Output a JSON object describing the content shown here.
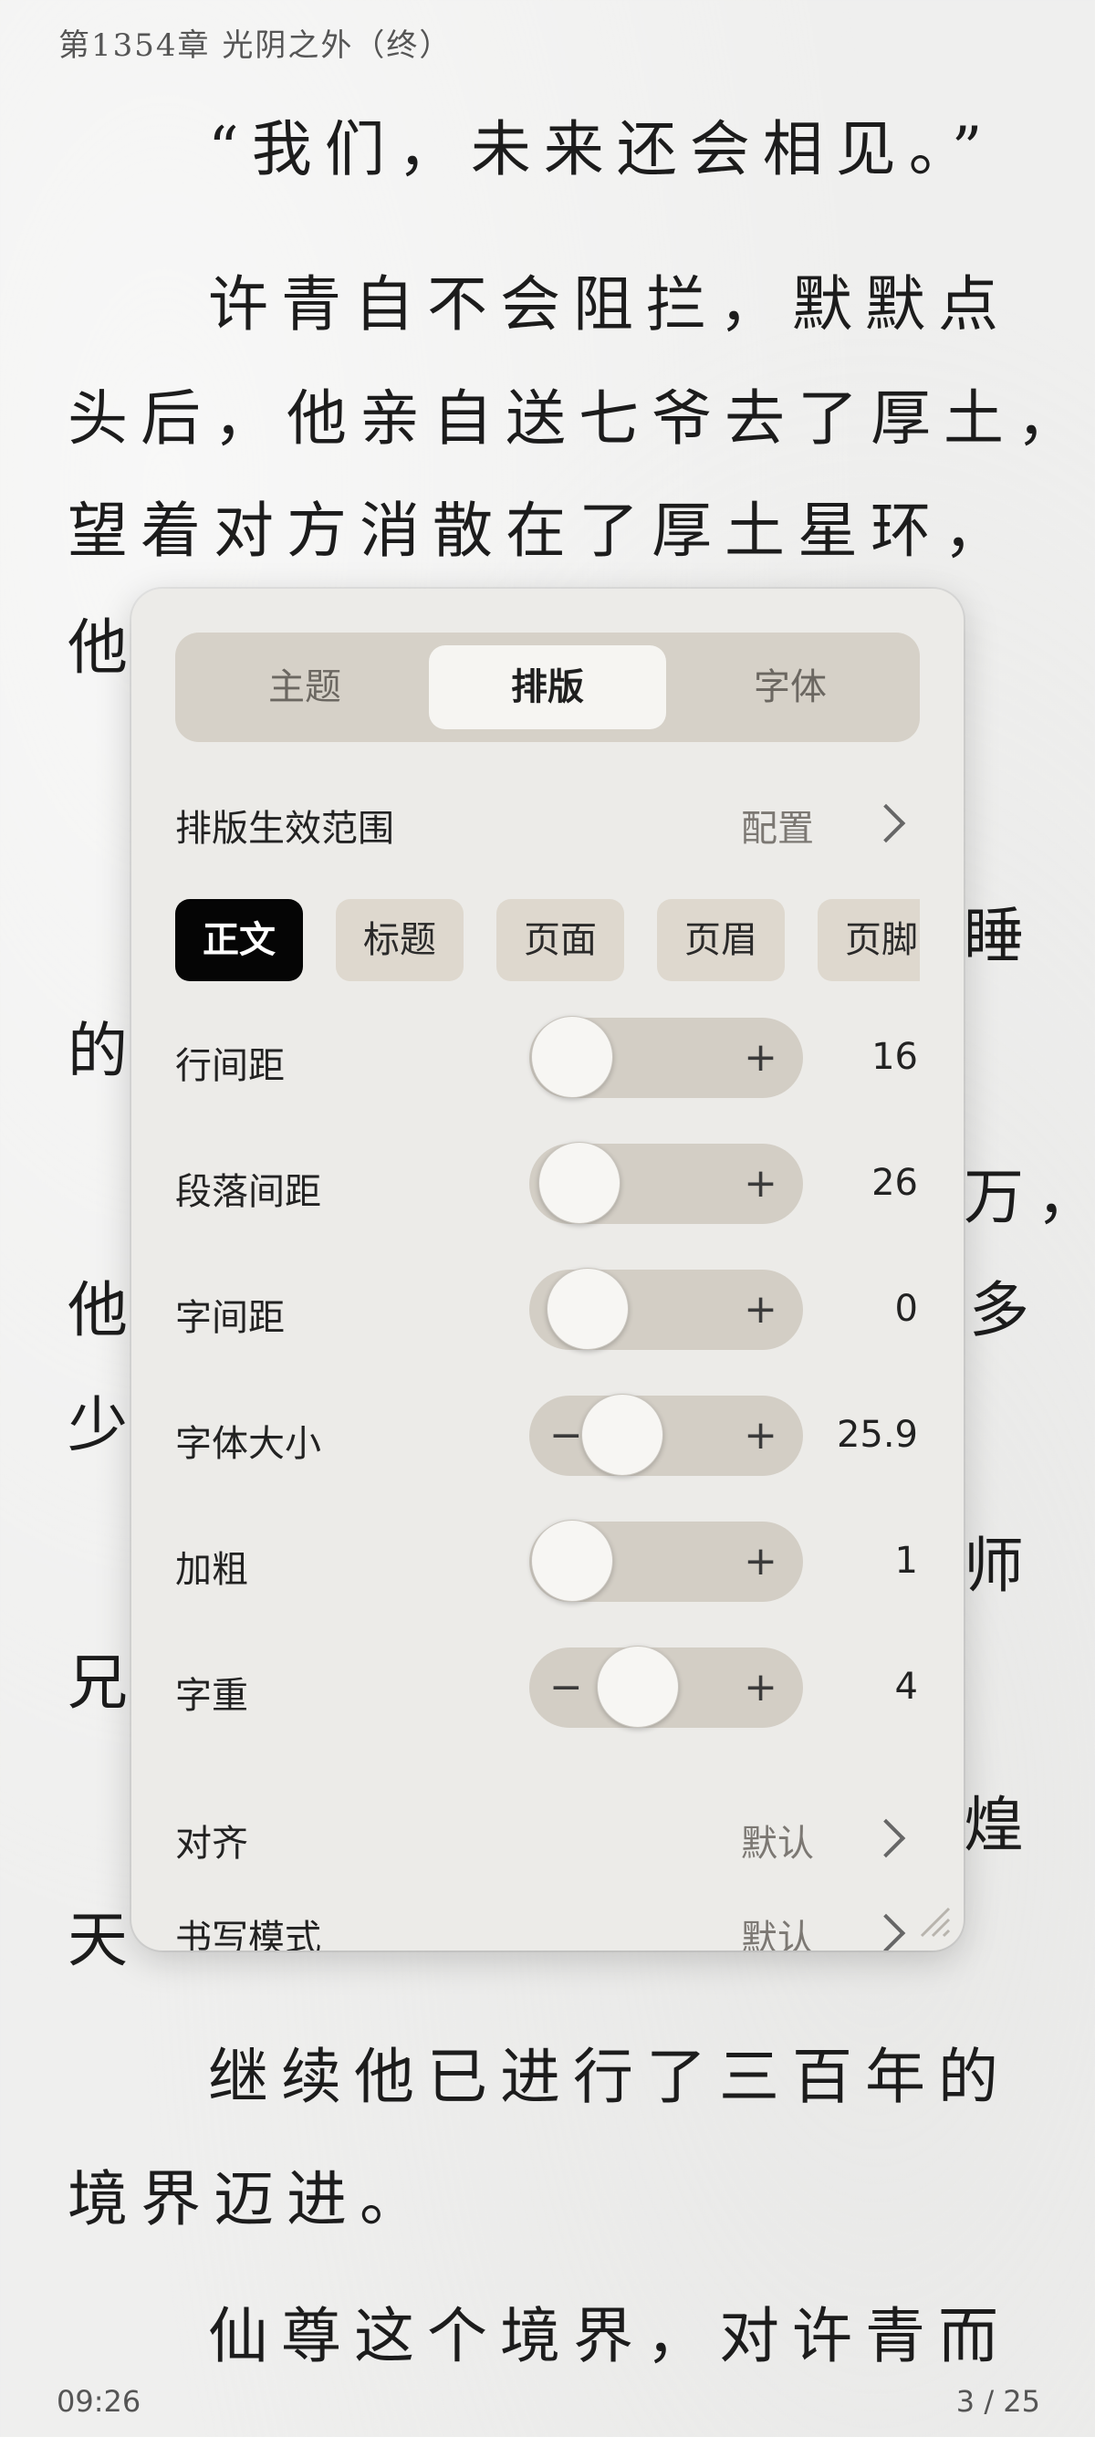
{
  "reader": {
    "chapter_title": "第1354章 光阴之外（终）",
    "lines": [
      "“我们，未来还会相见。”",
      "许青自不会阻拦，默默点",
      "头后，他亲自送七爷去了厚土，",
      "望着对方消散在了厚土星环，",
      "他",
      "睡",
      "的",
      "万，",
      "他",
      "多",
      "少",
      "师",
      "兄",
      "煌",
      "天",
      "继续他已进行了三百年的",
      "境界迈进。",
      "仙尊这个境界，对许青而"
    ],
    "time": "09:26",
    "page_indicator": "3 / 25"
  },
  "settings": {
    "tabs": [
      "主题",
      "排版",
      "字体"
    ],
    "active_tab": "排版",
    "scope": {
      "label": "排版生效范围",
      "value": "配置"
    },
    "chips": [
      "正文",
      "标题",
      "页面",
      "页眉",
      "页脚"
    ],
    "sliders": [
      {
        "label": "行间距",
        "value": "16",
        "level": 0.0,
        "show_minus": false
      },
      {
        "label": "段落间距",
        "value": "26",
        "level": 0.04,
        "show_minus": false
      },
      {
        "label": "字间距",
        "value": "0",
        "level": 0.08,
        "show_minus": false
      },
      {
        "label": "字体大小",
        "value": "25.9",
        "level": 0.26,
        "show_minus": true
      },
      {
        "label": "加粗",
        "value": "1",
        "level": 0.0,
        "show_minus": false
      },
      {
        "label": "字重",
        "value": "4",
        "level": 0.34,
        "show_minus": true
      }
    ],
    "align": {
      "label": "对齐",
      "value": "默认"
    },
    "writing_mode": {
      "label": "书写模式",
      "value": "默认"
    },
    "plus_symbol": "+",
    "minus_symbol": "−"
  }
}
